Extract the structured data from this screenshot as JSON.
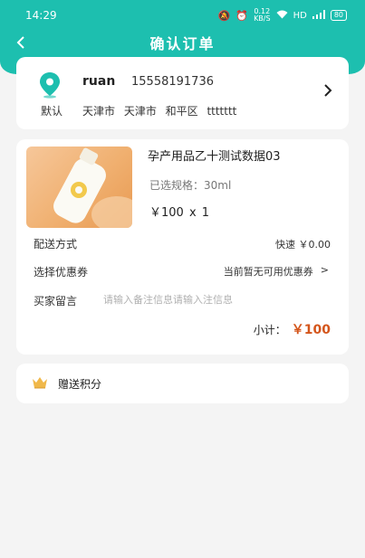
{
  "status_bar": {
    "time": "14:29",
    "network_speed_value": "0.12",
    "network_speed_unit": "KB/S",
    "hd": "HD",
    "signal": "46",
    "battery": "80"
  },
  "nav": {
    "back_icon": "chevron-left-icon",
    "title": "确认订单"
  },
  "address": {
    "default_label": "默认",
    "name": "ruan",
    "phone": "15558191736",
    "detail": "天津市 天津市 和平区 ttttttt",
    "pin_icon": "location-pin-icon",
    "arrow_icon": "chevron-right-icon"
  },
  "order": {
    "product_name": "孕产用品乙十测试数据03",
    "spec": "已选规格：30ml",
    "price": "￥100 x 1",
    "delivery_label": "配送方式",
    "delivery_value": "快速 ￥0.00",
    "coupon_label": "选择优惠券",
    "coupon_value": "当前暂无可用优惠券",
    "coupon_arrow": ">",
    "remark_label": "买家留言",
    "remark_placeholder": "请输入备注信息请输入注信息",
    "subtotal_label": "小计：",
    "subtotal_value": "￥100"
  },
  "points": {
    "label": "赠送积分",
    "icon": "crown-icon"
  },
  "colors": {
    "brand": "#1dbfaf",
    "price": "#d4561c",
    "background": "#f4f4f4"
  }
}
